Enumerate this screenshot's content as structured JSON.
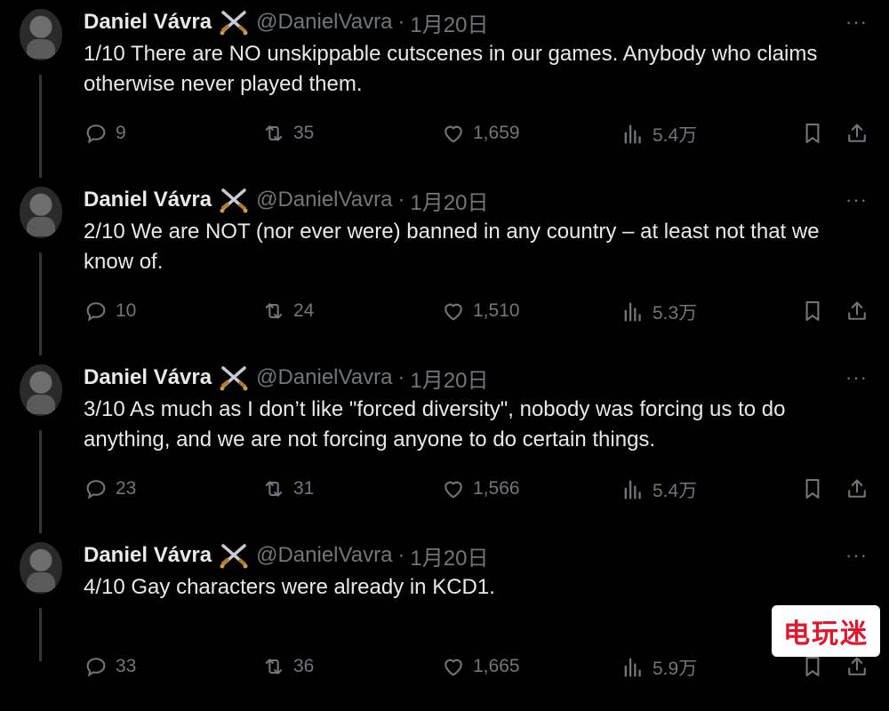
{
  "tweets": [
    {
      "name": "Daniel Vávra",
      "handle": "@DanielVavra",
      "dot": "·",
      "date": "1月20日",
      "more": "···",
      "text": "1/10 There are NO unskippable cutscenes in our games. Anybody who claims otherwise never played them.",
      "replies": "9",
      "retweets": "35",
      "likes": "1,659",
      "views": "5.4万"
    },
    {
      "name": "Daniel Vávra",
      "handle": "@DanielVavra",
      "dot": "·",
      "date": "1月20日",
      "more": "···",
      "text": "2/10  We are NOT (nor ever were) banned in any country – at least not that we know of.",
      "replies": "10",
      "retweets": "24",
      "likes": "1,510",
      "views": "5.3万"
    },
    {
      "name": "Daniel Vávra",
      "handle": "@DanielVavra",
      "dot": "·",
      "date": "1月20日",
      "more": "···",
      "text": "3/10 As much as I don’t like \"forced diversity\", nobody was forcing us to do anything, and we are not forcing anyone to do certain things.",
      "replies": "23",
      "retweets": "31",
      "likes": "1,566",
      "views": "5.4万"
    },
    {
      "name": "Daniel Vávra",
      "handle": "@DanielVavra",
      "dot": "·",
      "date": "1月20日",
      "more": "···",
      "text": "4/10 Gay characters were already in KCD1.",
      "replies": "33",
      "retweets": "36",
      "likes": "1,665",
      "views": "5.9万"
    }
  ],
  "watermark": "电玩迷",
  "icons": [
    "reply-icon",
    "retweet-icon",
    "like-icon",
    "views-icon",
    "bookmark-icon",
    "share-icon",
    "crossed-swords-icon"
  ],
  "colors": {
    "background": "#000000",
    "text": "#e7e9ea",
    "muted": "#71767b",
    "watermark": "#e0182d"
  }
}
